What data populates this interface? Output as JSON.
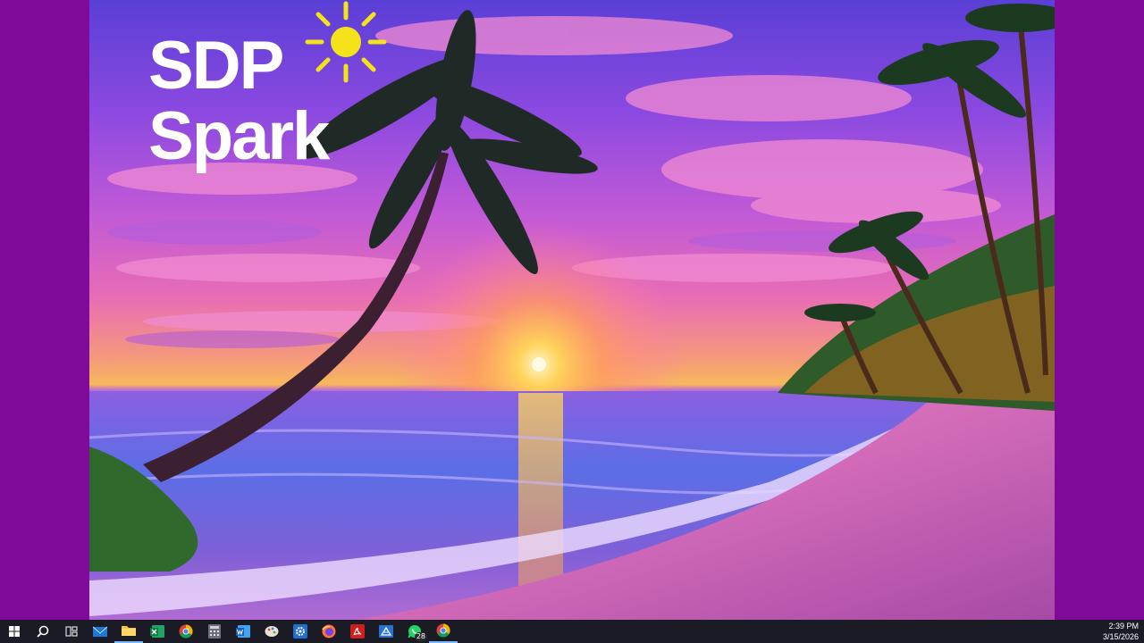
{
  "wallpaper": {
    "logo_line1": "SDP",
    "logo_line2": "Spark",
    "logo_icon": "sun-icon",
    "logo_color": "#ffffff",
    "sun_color": "#f4e21b",
    "frame_color": "#800a99"
  },
  "taskbar": {
    "items": [
      {
        "name": "start-button",
        "icon": "windows-logo-icon"
      },
      {
        "name": "search-button",
        "icon": "search-icon"
      },
      {
        "name": "task-view-button",
        "icon": "task-view-icon"
      },
      {
        "name": "mail-app",
        "icon": "mail-icon"
      },
      {
        "name": "file-explorer",
        "icon": "folder-icon"
      },
      {
        "name": "excel-app",
        "icon": "excel-icon"
      },
      {
        "name": "chrome-app",
        "icon": "chrome-icon"
      },
      {
        "name": "calculator-app",
        "icon": "calculator-icon"
      },
      {
        "name": "word-app",
        "icon": "word-icon"
      },
      {
        "name": "paint-app",
        "icon": "paint-icon"
      },
      {
        "name": "settings-app",
        "icon": "gear-icon"
      },
      {
        "name": "firefox-app",
        "icon": "firefox-icon"
      },
      {
        "name": "acrobat-app",
        "icon": "acrobat-icon"
      },
      {
        "name": "drive-app",
        "icon": "drive-icon"
      },
      {
        "name": "whatsapp-app",
        "icon": "whatsapp-icon",
        "badge": "28"
      },
      {
        "name": "chrome-canary-app",
        "icon": "chrome-icon"
      }
    ],
    "whatsapp_badge": "28",
    "clock_time": "2:39 PM",
    "clock_date": "3/15/2026",
    "accent_color": "#78b6ff"
  }
}
